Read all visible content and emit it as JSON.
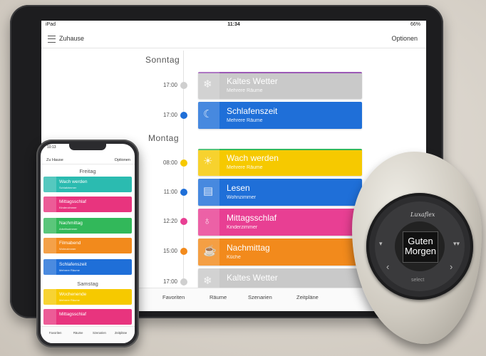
{
  "ipad": {
    "status": {
      "device": "iPad",
      "time": "11:34",
      "battery": "66%"
    },
    "nav": {
      "title": "Zuhause",
      "options": "Optionen"
    },
    "days": [
      "Sonntag",
      "Montag"
    ],
    "events": [
      {
        "time": "17:00",
        "title": "Kaltes Wetter",
        "sub": "Mehrere Räume",
        "color": "#c9c9c9",
        "dot": "#cfcfcf",
        "icon": "snow-icon"
      },
      {
        "time": "17:00",
        "title": "Schlafenszeit",
        "sub": "Mehrere Räume",
        "color": "#1f6fd8",
        "dot": "#1f6fd8",
        "icon": "moon-icon"
      },
      {
        "time": "08:00",
        "title": "Wach werden",
        "sub": "Mehrere Räume",
        "color": "#f6c900",
        "dot": "#f6c900",
        "icon": "sun-icon"
      },
      {
        "time": "11:00",
        "title": "Lesen",
        "sub": "Wohnzimmer",
        "color": "#1f6fd8",
        "dot": "#1f6fd8",
        "icon": "book-icon"
      },
      {
        "time": "12:20",
        "title": "Mittagsschlaf",
        "sub": "Kinderzimmer",
        "color": "#e83f93",
        "dot": "#e83f93",
        "icon": "stroller-icon"
      },
      {
        "time": "15:00",
        "title": "Nachmittag",
        "sub": "Küche",
        "color": "#f28a1c",
        "dot": "#f28a1c",
        "icon": "cup-icon"
      },
      {
        "time": "17:00",
        "title": "Kaltes Wetter",
        "sub": "",
        "color": "#c9c9c9",
        "dot": "#cfcfcf",
        "icon": "snow-icon"
      }
    ],
    "tabs": [
      "Favoriten",
      "Räume",
      "Szenarien",
      "Zeitpläne"
    ]
  },
  "phone": {
    "time": "10:13",
    "nav": {
      "back": "Zu Hause",
      "options": "Optionen"
    },
    "days": [
      "Freitag",
      "Samstag"
    ],
    "cards": [
      {
        "title": "Wach werden",
        "sub": "Schlafzimmer",
        "color": "#2bbbb0"
      },
      {
        "title": "Mittagsschlaf",
        "sub": "Kinderzimmer",
        "color": "#e8347e"
      },
      {
        "title": "Nachmittag",
        "sub": "Arbeitszimmer",
        "color": "#32b85a"
      },
      {
        "title": "Filmabend",
        "sub": "Wohnzimmer",
        "color": "#f28a1c"
      },
      {
        "title": "Schlafenszeit",
        "sub": "Mehrere Räume",
        "color": "#1f6fd8"
      },
      {
        "title": "Wochenende",
        "sub": "Mehrere Räume",
        "color": "#f6c900"
      },
      {
        "title": "Mittagsschlaf",
        "sub": "",
        "color": "#e8347e"
      }
    ],
    "tabs": [
      "Favoriten",
      "Räume",
      "Szenarien",
      "Zeitpläne"
    ]
  },
  "remote": {
    "logo": "Luxaflex",
    "display": [
      "Guten",
      "Morgen"
    ],
    "select": "select"
  }
}
